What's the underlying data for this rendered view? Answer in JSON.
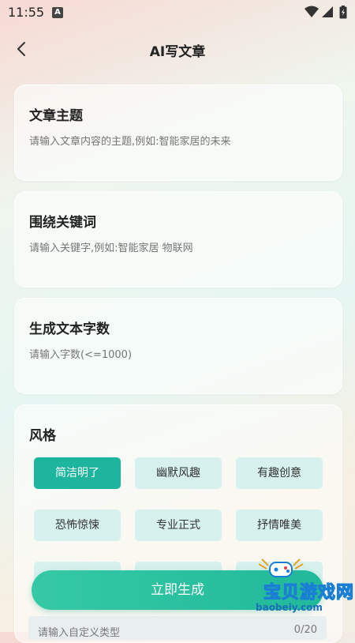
{
  "status_bar": {
    "time": "11:55",
    "a_badge": "A"
  },
  "header": {
    "title": "AI写文章"
  },
  "topic": {
    "label": "文章主题",
    "placeholder": "请输入文章内容的主题,例如:智能家居的未来"
  },
  "keywords": {
    "label": "围绕关键词",
    "placeholder": "请输入关键字,例如:智能家居 物联网"
  },
  "word_count": {
    "label": "生成文本字数",
    "placeholder": "请输入字数(<=1000)"
  },
  "style": {
    "label": "风格",
    "selected": "简洁明了",
    "options": [
      "简洁明了",
      "幽默风趣",
      "有趣创意",
      "恐怖惊悚",
      "专业正式",
      "抒情唯美"
    ]
  },
  "generate_button": {
    "label": "立即生成"
  },
  "custom_type": {
    "placeholder": "请输入自定义类型",
    "counter": "0/20"
  },
  "watermark": {
    "text": "宝贝游戏网",
    "url": "baobeiy.com"
  },
  "colors": {
    "accent": "#1DB59D",
    "chip_bg": "#D6F1EE"
  }
}
